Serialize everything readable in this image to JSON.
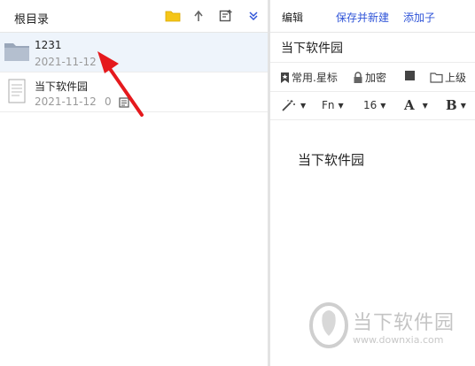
{
  "left_panel": {
    "title": "根目录",
    "toolbar_icons": [
      "folder-icon",
      "up-arrow-icon",
      "new-note-icon",
      "expand-down-icon"
    ],
    "items": [
      {
        "name": "1231",
        "date": "2021-11-12",
        "type": "folder",
        "selected": true
      },
      {
        "name": "当下软件园",
        "date": "2021-11-12",
        "count": "0",
        "type": "note",
        "selected": false
      }
    ]
  },
  "right_panel": {
    "header": {
      "edit_label": "编辑",
      "save_new_label": "保存并新建",
      "add_child_label": "添加子"
    },
    "doc_title": "当下软件园",
    "toolbar1": {
      "common_label": "常用.星标",
      "encrypt_label": "加密",
      "parent_label": "上级"
    },
    "toolbar2": {
      "font_label": "Fn",
      "font_size": "16",
      "font_color_label": "A",
      "bold_label": "B"
    },
    "content_text": "当下软件园"
  },
  "watermark": {
    "text": "当下软件园",
    "url": "www.downxia.com"
  },
  "colors": {
    "link_blue": "#2f54d8",
    "selected_row": "#eef4fb",
    "arrow_red": "#e5191d",
    "folder_yellow": "#f5c518"
  }
}
